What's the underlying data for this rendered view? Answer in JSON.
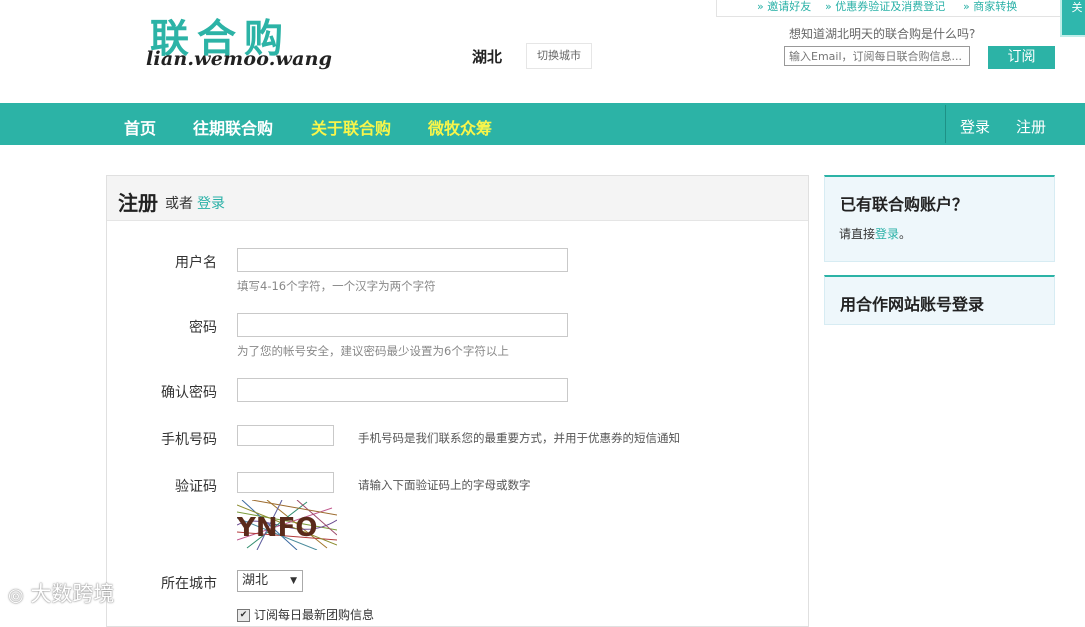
{
  "top_links": [
    "邀请好友",
    "优惠券验证及消费登记",
    "商家转换"
  ],
  "corner_tab": "关",
  "logo": {
    "cn": "联合购",
    "en": "lian.wemoo.wang"
  },
  "city": {
    "name": "湖北",
    "switch_label": "切换城市"
  },
  "subscribe": {
    "question": "想知道湖北明天的联合购是什么吗?",
    "placeholder": "输入Email，订阅每日联合购信息...",
    "button": "订阅"
  },
  "nav": {
    "items": [
      "首页",
      "往期联合购",
      "关于联合购",
      "微牧众筹"
    ],
    "login": "登录",
    "register": "注册"
  },
  "form": {
    "title": "注册",
    "or": "或者",
    "login_link": "登录",
    "username_label": "用户名",
    "username_hint": "填写4-16个字符，一个汉字为两个字符",
    "password_label": "密码",
    "password_hint": "为了您的帐号安全，建议密码最少设置为6个字符以上",
    "confirm_label": "确认密码",
    "phone_label": "手机号码",
    "phone_hint": "手机号码是我们联系您的最重要方式，并用于优惠券的短信通知",
    "captcha_label": "验证码",
    "captcha_hint": "请输入下面验证码上的字母或数字",
    "captcha_text": "YNFO",
    "city_label": "所在城市",
    "city_value": "湖北",
    "subscribe_check": "订阅每日最新团购信息"
  },
  "sidebar": {
    "has_account_title": "已有联合购账户？",
    "has_account_prefix": "请直接",
    "has_account_link": "登录",
    "has_account_suffix": "。",
    "partner_title": "用合作网站账号登录"
  },
  "watermark": "大数跨境",
  "colors": {
    "brand": "#2cb3a6",
    "highlight": "#f8f54a"
  }
}
